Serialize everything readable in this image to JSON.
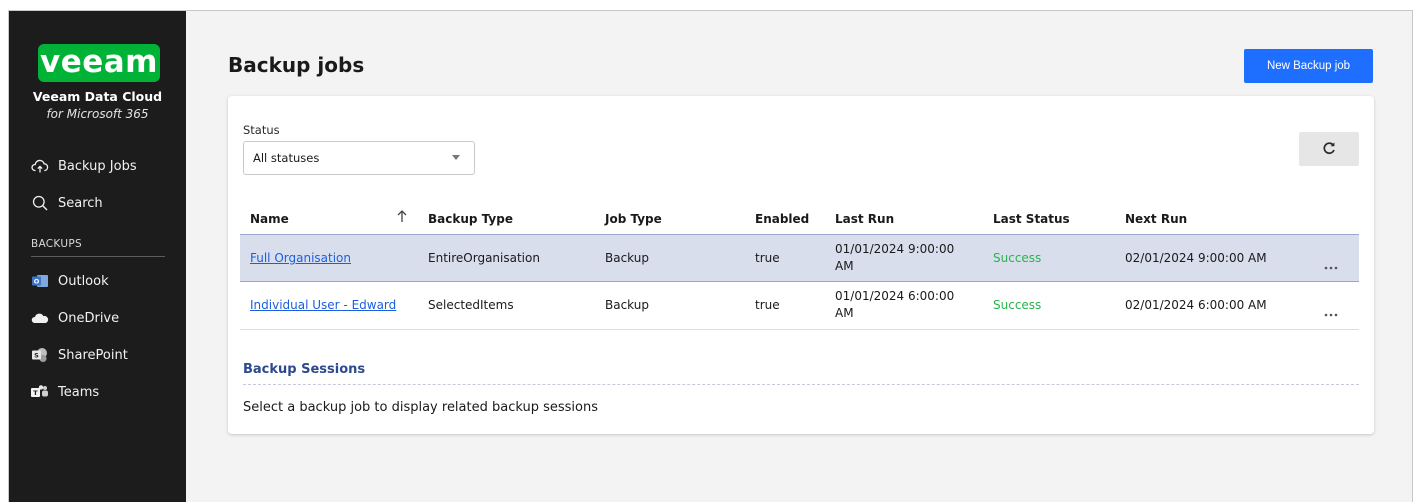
{
  "sidebar": {
    "logo_text": "veeam",
    "brand_title": "Veeam Data Cloud",
    "brand_subtitle": "for Microsoft 365",
    "nav": [
      {
        "label": "Backup Jobs",
        "icon": "cloud-upload-icon"
      },
      {
        "label": "Search",
        "icon": "search-icon"
      }
    ],
    "section_label": "BACKUPS",
    "backups": [
      {
        "label": "Outlook",
        "icon": "outlook-icon"
      },
      {
        "label": "OneDrive",
        "icon": "onedrive-icon"
      },
      {
        "label": "SharePoint",
        "icon": "sharepoint-icon"
      },
      {
        "label": "Teams",
        "icon": "teams-icon"
      }
    ]
  },
  "header": {
    "title": "Backup jobs",
    "new_button": "New Backup job"
  },
  "filter": {
    "label": "Status",
    "selected": "All statuses"
  },
  "table": {
    "columns": [
      "Name",
      "Backup Type",
      "Job Type",
      "Enabled",
      "Last Run",
      "Last Status",
      "Next Run"
    ],
    "sort_column": "Name",
    "sort_direction": "ascending",
    "rows": [
      {
        "name": "Full Organisation",
        "backup_type": "EntireOrganisation",
        "job_type": "Backup",
        "enabled": "true",
        "last_run": "01/01/2024 9:00:00 AM",
        "last_status": "Success",
        "next_run": "02/01/2024 9:00:00 AM",
        "selected": true
      },
      {
        "name": "Individual User - Edward",
        "backup_type": "SelectedItems",
        "job_type": "Backup",
        "enabled": "true",
        "last_run": "01/01/2024 6:00:00 AM",
        "last_status": "Success",
        "next_run": "02/01/2024 6:00:00 AM",
        "selected": false
      }
    ]
  },
  "sessions": {
    "title": "Backup Sessions",
    "empty_message": "Select a backup job to display related backup sessions"
  },
  "colors": {
    "sidebar_bg": "#1c1c1c",
    "brand_green": "#00b336",
    "primary_blue": "#1e6fff",
    "link_blue": "#1b5fe0",
    "success_green": "#27b44b",
    "selected_row": "#d9deed"
  }
}
